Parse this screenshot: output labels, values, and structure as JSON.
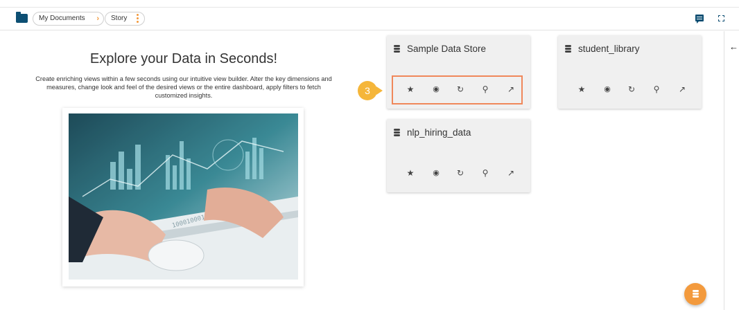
{
  "breadcrumb": {
    "items": [
      {
        "label": "My Documents",
        "separator": "›"
      },
      {
        "label": "Story"
      }
    ]
  },
  "toolbar": {
    "icons": [
      "comment-icon",
      "expand-icon"
    ]
  },
  "hero": {
    "title": "Explore your Data in Seconds!",
    "description": "Create enriching views within a few seconds using our intuitive view builder. Alter the key dimensions and measures, change look and feel of the desired views or the entire dashboard, apply filters to fetch customized insights.",
    "image": "hands-on-laptop-data-charts-illustration"
  },
  "datastores": [
    {
      "name": "Sample Data Store"
    },
    {
      "name": "student_library"
    },
    {
      "name": "nlp_hiring_data"
    }
  ],
  "card_actions": [
    "star-icon",
    "eye-icon",
    "refresh-icon",
    "search-icon",
    "chart-icon"
  ],
  "annotation": {
    "step": "3"
  },
  "colors": {
    "accent": "#f39a3d",
    "primary": "#0d4f73",
    "highlight_border": "#f0875a",
    "badge": "#f5b63a",
    "card_bg": "#f0f0f0"
  }
}
